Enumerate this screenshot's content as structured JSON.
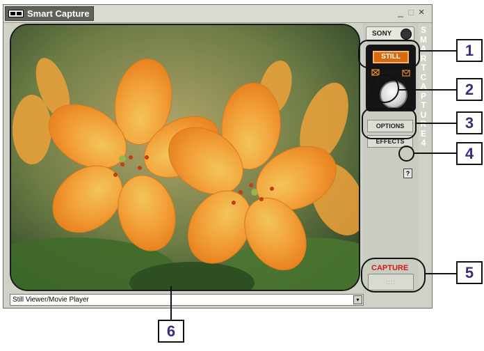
{
  "window": {
    "title": "Smart Capture",
    "controls": [
      "_",
      "□",
      "×"
    ]
  },
  "status_bar": {
    "text": "Still Viewer/Movie Player",
    "dropdown_glyph": "▾"
  },
  "panel": {
    "brand": "SONY",
    "mode_label": "STILL",
    "options_label": "OPTIONS",
    "effects_label": "EFFECTS",
    "help_glyph": "?",
    "vertical_text": "SMART CAPTURE 4",
    "capture_label": "CAPTURE",
    "capture_grip": "::::"
  },
  "callouts": [
    "1",
    "2",
    "3",
    "4",
    "5",
    "6"
  ],
  "colors": {
    "accent": "#d86a10",
    "capture_text": "#d01818",
    "callout_text": "#3b2d7e"
  },
  "icons": [
    "app-logo-icon",
    "camera-icon",
    "mail-icon",
    "help-icon",
    "dropdown-arrow-icon",
    "knob-icon"
  ]
}
